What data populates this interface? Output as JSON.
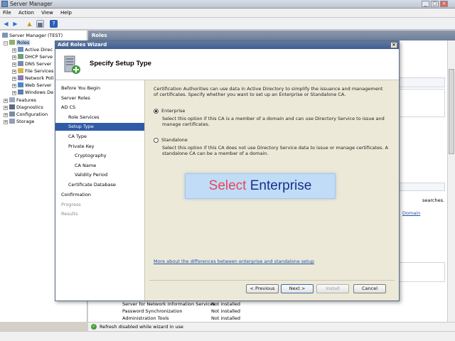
{
  "window": {
    "title": "Server Manager",
    "controls": [
      "_",
      "□",
      "×"
    ]
  },
  "menu": [
    "File",
    "Action",
    "View",
    "Help"
  ],
  "tree": {
    "root": "Server Manager (TEST)",
    "roles": "Roles",
    "role_items": [
      "Active Direc",
      "DHCP Serve",
      "DNS Server",
      "File Services",
      "Network Poli",
      "Web Server",
      "Windows De"
    ],
    "others": [
      "Features",
      "Diagnostics",
      "Configuration",
      "Storage"
    ]
  },
  "content": {
    "header": "Roles",
    "right_fragments": {
      "searches": "searches.",
      "domain": "Domain"
    },
    "services": [
      {
        "name": "Server for Network Information Services",
        "status": "Not installed"
      },
      {
        "name": "Password Synchronization",
        "status": "Not installed"
      },
      {
        "name": "Administration Tools",
        "status": "Not installed"
      }
    ]
  },
  "status": {
    "text": "Refresh disabled while wizard in use"
  },
  "dialog": {
    "title": "Add Roles Wizard",
    "heading": "Specify Setup Type",
    "nav": [
      {
        "label": "Before You Begin",
        "state": "normal"
      },
      {
        "label": "Server Roles",
        "state": "normal"
      },
      {
        "label": "AD CS",
        "state": "normal"
      },
      {
        "label": "Role Services",
        "state": "normal"
      },
      {
        "label": "Setup Type",
        "state": "active"
      },
      {
        "label": "CA Type",
        "state": "normal"
      },
      {
        "label": "Private Key",
        "state": "normal"
      },
      {
        "label": "Cryptography",
        "state": "normal"
      },
      {
        "label": "CA Name",
        "state": "normal"
      },
      {
        "label": "Validity Period",
        "state": "normal"
      },
      {
        "label": "Certificate Database",
        "state": "normal"
      },
      {
        "label": "Confirmation",
        "state": "normal"
      },
      {
        "label": "Progress",
        "state": "dim"
      },
      {
        "label": "Results",
        "state": "dim"
      }
    ],
    "intro": "Certification Authorities can use data in Active Directory to simplify the issuance and management of certificates. Specify whether you want to set up an Enterprise or Standalone CA.",
    "options": [
      {
        "label": "Enterprise",
        "selected": true,
        "description": "Select this option if this CA is a member of a domain and can use Directory Service to issue and manage certificates."
      },
      {
        "label": "Standalone",
        "selected": false,
        "description": "Select this option if this CA does not use Directory Service data to issue or manage certificates. A standalone CA can be a member of a domain."
      }
    ],
    "more_link": "More about the differences between enterprise and standalone setup",
    "buttons": {
      "previous": "< Previous",
      "next": "Next >",
      "install": "Install",
      "cancel": "Cancel"
    }
  },
  "banner": {
    "word1": "Select",
    "word2": "Enterprise"
  },
  "colors": {
    "active_step": "#2f5aa8",
    "banner_bg": "#c0dcf7",
    "banner_word1": "#e3475b",
    "banner_word2": "#1a2f8a"
  }
}
